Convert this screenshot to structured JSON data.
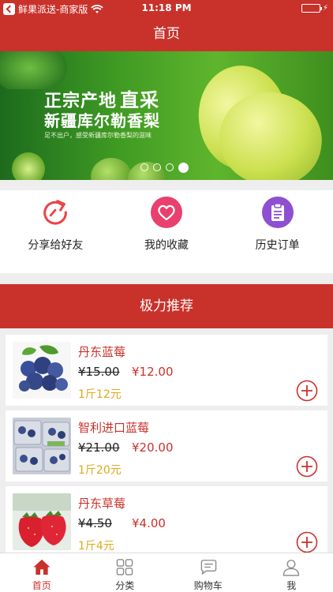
{
  "status_bar": {
    "carrier": "鲜果派送-商家版",
    "time": "11:18 PM"
  },
  "nav": {
    "title": "首页"
  },
  "banner": {
    "headline": "正宗产地",
    "headline_emphasis": "直采",
    "subheadline": "新疆库尔勒香梨",
    "caption": "足不出户，感受新疆库尔勒香梨的滋味",
    "page_count": 4,
    "active_page": 4
  },
  "quick_actions": [
    {
      "label": "分享给好友",
      "icon": "share-icon",
      "color": "#e9454a"
    },
    {
      "label": "我的收藏",
      "icon": "heart-icon",
      "color": "#e9406e"
    },
    {
      "label": "历史订单",
      "icon": "clipboard-icon",
      "color": "#8e4fd0"
    }
  ],
  "recommend": {
    "title": "极力推荐"
  },
  "products": [
    {
      "name": "丹东蓝莓",
      "old_price": "¥15.00",
      "price": "¥12.00",
      "unit": "1斤12元",
      "image": "blueberry-image"
    },
    {
      "name": "智利进口蓝莓",
      "old_price": "¥21.00",
      "price": "¥20.00",
      "unit": "1斤20元",
      "image": "packaged-blueberry-image"
    },
    {
      "name": "丹东草莓",
      "old_price": "¥4.50",
      "price": "¥4.00",
      "unit": "1斤4元",
      "image": "strawberry-image"
    }
  ],
  "tabs": [
    {
      "label": "首页",
      "icon": "home-icon",
      "active": true
    },
    {
      "label": "分类",
      "icon": "grid-icon",
      "active": false
    },
    {
      "label": "购物车",
      "icon": "cart-icon",
      "active": false
    },
    {
      "label": "我",
      "icon": "person-icon",
      "active": false
    }
  ],
  "colors": {
    "primary": "#c9322b",
    "unit_text": "#e0a918",
    "background": "#eeeeee"
  }
}
